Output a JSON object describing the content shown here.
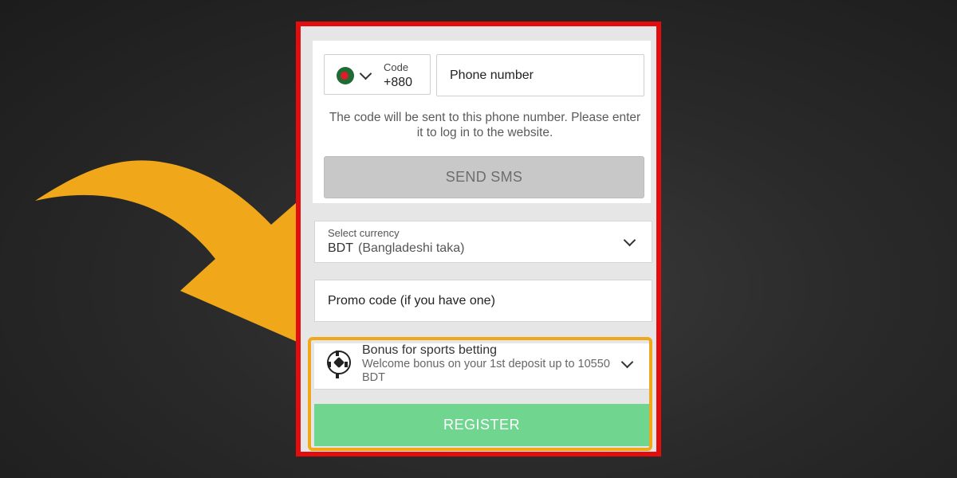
{
  "colors": {
    "frame_border": "#e30d0d",
    "highlight_border": "#f0a81a",
    "arrow": "#f0a81a",
    "register_button": "#6fd58f",
    "send_sms_button": "#c8c8c8"
  },
  "phone_section": {
    "country_flag": "bangladesh-flag-icon",
    "code_label": "Code",
    "code_value": "+880",
    "phone_placeholder": "Phone number",
    "hint_text": "The code will be sent to this phone number. Please enter it to log in to the website.",
    "send_sms_label": "SEND SMS"
  },
  "currency": {
    "label": "Select currency",
    "code": "BDT",
    "description": "(Bangladeshi taka)"
  },
  "promo": {
    "placeholder": "Promo code (if you have one)"
  },
  "bonus": {
    "icon": "soccer-ball-icon",
    "title": "Bonus for sports betting",
    "subtitle": "Welcome bonus on your 1st deposit up to 10550 BDT"
  },
  "register_label": "REGISTER"
}
